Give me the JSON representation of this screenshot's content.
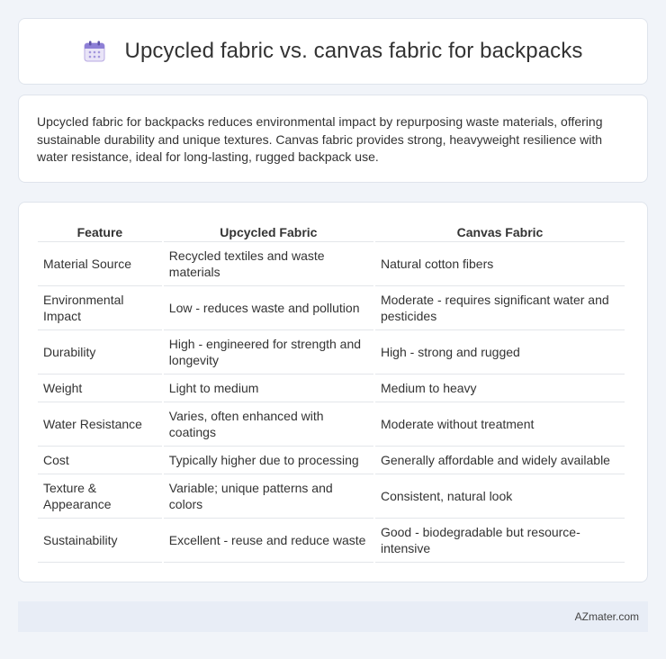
{
  "header": {
    "icon": "calendar-icon",
    "title": "Upcycled fabric vs. canvas fabric for backpacks"
  },
  "intro": {
    "text": "Upcycled fabric for backpacks reduces environmental impact by repurposing waste materials, offering sustainable durability and unique textures. Canvas fabric provides strong, heavyweight resilience with water resistance, ideal for long-lasting, rugged backpack use."
  },
  "table": {
    "headers": [
      "Feature",
      "Upcycled Fabric",
      "Canvas Fabric"
    ],
    "rows": [
      [
        "Material Source",
        "Recycled textiles and waste materials",
        "Natural cotton fibers"
      ],
      [
        "Environmental Impact",
        "Low - reduces waste and pollution",
        "Moderate - requires significant water and pesticides"
      ],
      [
        "Durability",
        "High - engineered for strength and longevity",
        "High - strong and rugged"
      ],
      [
        "Weight",
        "Light to medium",
        "Medium to heavy"
      ],
      [
        "Water Resistance",
        "Varies, often enhanced with coatings",
        "Moderate without treatment"
      ],
      [
        "Cost",
        "Typically higher due to processing",
        "Generally affordable and widely available"
      ],
      [
        "Texture & Appearance",
        "Variable; unique patterns and colors",
        "Consistent, natural look"
      ],
      [
        "Sustainability",
        "Excellent - reuse and reduce waste",
        "Good - biodegradable but resource-intensive"
      ]
    ]
  },
  "footer": {
    "site": "AZmater.com"
  }
}
